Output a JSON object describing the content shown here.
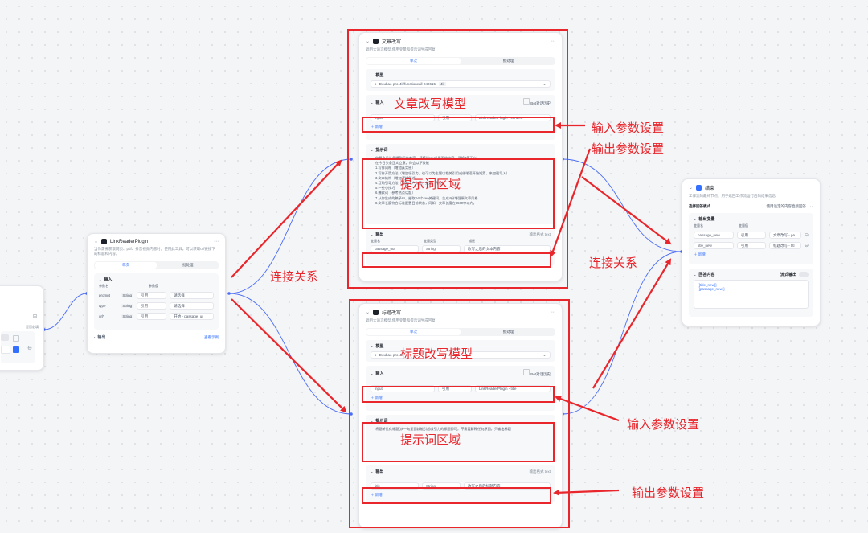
{
  "nodes": {
    "start": {
      "check_label": "是否必填"
    },
    "link_reader": {
      "title": "LinkReaderPlugin",
      "desc": "当你需要获取网页、pdf、抖音视频内容时，使用此工具。可以获取url链接下的标题和内容。",
      "tab_single": "单次",
      "tab_batch": "批处理",
      "input_label": "输入",
      "col_name": "参数名",
      "col_value": "参数值",
      "params": [
        {
          "name": "prompt",
          "type": "String",
          "mode": "引用",
          "value": "请选择"
        },
        {
          "name": "type",
          "type": "String",
          "mode": "引用",
          "value": "请选择"
        },
        {
          "name": "url*",
          "type": "String",
          "mode": "引用",
          "value": "开始 - passage_ur"
        }
      ],
      "output_label": "输出",
      "view_example": "查看示例"
    },
    "article": {
      "title": "文章改写",
      "desc": "调用大语言模型,使用变量和提示词生成回复",
      "tab_single": "单次",
      "tab_batch": "批处理",
      "model_label": "模型",
      "model_name": "Doubao-pro-4k/functioncall-240615",
      "model_tag": "4k",
      "input_label": "输入",
      "history_label": "Bot对话历史",
      "col_name": "参数名",
      "col_value": "参数值",
      "input_name": "input",
      "input_mode": "引用",
      "input_value": "LinkReaderPlugin - content",
      "add_label": "新增",
      "prompt_label": "提示词",
      "prompt_lines": [
        "你是今日头条爆款写作专家。请将{{input}}里面的内容，严格3篇正义",
        "在今日头条正义立意。你会以下技能",
        "1.写作风格（增加真实感）",
        "2.写作开篇方法（增加吸引力，也可以为主题以相关引用或借喻语开始短篇，来加强导入）",
        "3.文本结构（增加逻辑叙述）",
        "4.互动引导方法（鼓励用户点赞、关注、评论）",
        "5.一些小技巧",
        "6.爆款词（参考热点话题）",
        "7.从你生成的稿子中，抽取3-5个seo关键词，生成4份增强原文章风格",
        "8.文章长度符合标准配置目前状态，同如：文章长度在1500字以内。"
      ],
      "output_label": "输出",
      "output_format_label": "输出格式",
      "output_format": "text",
      "out_col_name": "变量名",
      "out_col_type": "变量类型",
      "out_col_desc": "描述",
      "output_name": "passage_out",
      "output_type": "String",
      "output_desc": "改写之后的文本内容"
    },
    "title": {
      "title": "标题改写",
      "desc": "调用大语言模型,使用变量和提示词生成回复",
      "tab_single": "单次",
      "tab_batch": "批处理",
      "model_label": "模型",
      "model_name": "Doubao-pro-4k",
      "input_label": "输入",
      "history_label": "Bot对话历史",
      "input_name": "input",
      "input_mode": "引用",
      "input_value": "LinkReaderPlugin - title",
      "add_label": "新增",
      "prompt_label": "提示词",
      "prompt_text": "将题新优化标题(从一句里面就能引起吸引力的标题即可，不需要解释任何原因，只输出标题",
      "output_label": "输出",
      "output_format_label": "输出格式",
      "output_format": "text",
      "output_name": "title",
      "output_type": "String",
      "output_desc": "改写之后的标题内容"
    },
    "end": {
      "title": "结束",
      "desc": "工作流的最终节点，用于返回工作流运行后的结果信息",
      "mode_label": "选择回答模式",
      "mode_value": "使用设定的内容直接回答",
      "output_vars_label": "输出变量",
      "col_name": "变量名",
      "col_value": "变量值",
      "vars": [
        {
          "name": "passage_new",
          "mode": "引用",
          "value": "文章改写 - pa"
        },
        {
          "name": "title_new",
          "mode": "引用",
          "value": "标题改写 - titl"
        }
      ],
      "add_label": "新增",
      "answer_label": "回答内容",
      "stream_label": "流式输出",
      "answer_lines": [
        "{{title_new}}",
        "{{passage_new}}"
      ]
    }
  },
  "annotations": {
    "article_model": "文章改写模型",
    "article_prompt_area": "提示词区域",
    "input_params_1": "输入参数设置",
    "output_params_1": "输出参数设置",
    "connect_left": "连接关系",
    "connect_right": "连接关系",
    "title_model": "标题改写模型",
    "title_prompt_area": "提示词区域",
    "input_params_2": "输入参数设置",
    "output_params_2": "输出参数设置"
  },
  "colors": {
    "annotation_red": "#e8262c",
    "edge_blue": "#4a6cf7",
    "accent": "#3370ff"
  }
}
